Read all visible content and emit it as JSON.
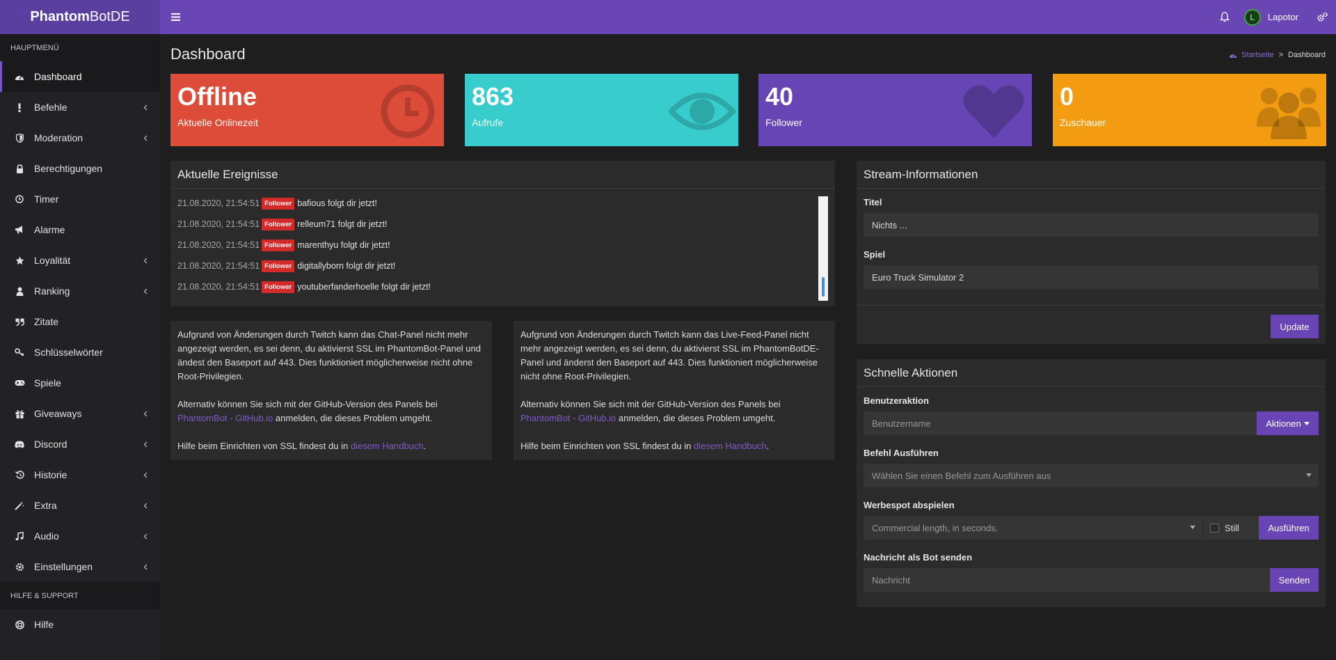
{
  "header": {
    "logo_bold": "Phantom",
    "logo_rest": "BotDE",
    "user_name": "Lapotor"
  },
  "sidebar": {
    "main_header": "HAUPTMENÜ",
    "items": [
      {
        "label": "Dashboard",
        "icon": "dashboard-icon",
        "chevron": false
      },
      {
        "label": "Befehle",
        "icon": "exclamation-icon",
        "chevron": true
      },
      {
        "label": "Moderation",
        "icon": "shield-icon",
        "chevron": true
      },
      {
        "label": "Berechtigungen",
        "icon": "lock-icon",
        "chevron": false
      },
      {
        "label": "Timer",
        "icon": "clock-icon",
        "chevron": false
      },
      {
        "label": "Alarme",
        "icon": "megaphone-icon",
        "chevron": false
      },
      {
        "label": "Loyalität",
        "icon": "star-icon",
        "chevron": true
      },
      {
        "label": "Ranking",
        "icon": "user-icon",
        "chevron": true
      },
      {
        "label": "Zitate",
        "icon": "quote-icon",
        "chevron": false
      },
      {
        "label": "Schlüsselwörter",
        "icon": "key-icon",
        "chevron": false
      },
      {
        "label": "Spiele",
        "icon": "gamepad-icon",
        "chevron": false
      },
      {
        "label": "Giveaways",
        "icon": "gift-icon",
        "chevron": true
      },
      {
        "label": "Discord",
        "icon": "discord-icon",
        "chevron": true
      },
      {
        "label": "Historie",
        "icon": "history-icon",
        "chevron": true
      },
      {
        "label": "Extra",
        "icon": "magic-wand-icon",
        "chevron": true
      },
      {
        "label": "Audio",
        "icon": "music-icon",
        "chevron": true
      },
      {
        "label": "Einstellungen",
        "icon": "gear-icon",
        "chevron": true
      }
    ],
    "help_header": "HILFE & SUPPORT",
    "help_item": "Hilfe"
  },
  "main": {
    "page_title": "Dashboard",
    "breadcrumb_home": "Startseite",
    "breadcrumb_sep": ">",
    "breadcrumb_current": "Dashboard",
    "stat_boxes": [
      {
        "value": "Offline",
        "label": "Aktuelle Onlinezeit",
        "color": "#dd4b39",
        "icon": "clock-icon"
      },
      {
        "value": "863",
        "label": "Aufrufe",
        "color": "#39cccc",
        "icon": "eye-icon"
      },
      {
        "value": "40",
        "label": "Follower",
        "color": "#6745b5",
        "icon": "heart-icon"
      },
      {
        "value": "0",
        "label": "Zuschauer",
        "color": "#f39c12",
        "icon": "users-icon"
      }
    ],
    "events": {
      "title": "Aktuelle Ereignisse",
      "rows": [
        {
          "time": "21.08.2020, 21:54:51",
          "badge": "Follower",
          "msg": "bafious folgt dir jetzt!"
        },
        {
          "time": "21.08.2020, 21:54:51",
          "badge": "Follower",
          "msg": "relleum71 folgt dir jetzt!"
        },
        {
          "time": "21.08.2020, 21:54:51",
          "badge": "Follower",
          "msg": "marenthyu folgt dir jetzt!"
        },
        {
          "time": "21.08.2020, 21:54:51",
          "badge": "Follower",
          "msg": "digitallyborn folgt dir jetzt!"
        },
        {
          "time": "21.08.2020, 21:54:51",
          "badge": "Follower",
          "msg": "youtuberfanderhoelle folgt dir jetzt!"
        }
      ]
    },
    "chat_panel": {
      "p1": "Aufgrund von Änderungen durch Twitch kann das Chat-Panel nicht mehr angezeigt werden, es sei denn, du aktivierst SSL im PhantomBot-Panel und ändest den Baseport auf 443. Dies funktioniert möglicherweise nicht ohne Root-Privilegien.",
      "p2_pre": "Alternativ können Sie sich mit der GitHub-Version des Panels bei ",
      "p2_link": "PhantomBot - GitHub.io",
      "p2_post": " anmelden, die dieses Problem umgeht.",
      "p3_pre": "Hilfe beim Einrichten von SSL findest du in ",
      "p3_link": "diesem Handbuch",
      "p3_post": "."
    },
    "feed_panel": {
      "p1": "Aufgrund von Änderungen durch Twitch kann das Live-Feed-Panel nicht mehr angezeigt werden, es sei denn, du aktivierst SSL im PhantomBotDE-Panel und änderst den Baseport auf 443. Dies funktioniert möglicherweise nicht ohne Root-Privilegien.",
      "p2_pre": "Alternativ können Sie sich mit der GitHub-Version des Panels bei ",
      "p2_link": "PhantomBot - GitHub.io",
      "p2_post": " anmelden, die dieses Problem umgeht.",
      "p3_pre": "Hilfe beim Einrichten von SSL findest du in ",
      "p3_link": "diesem Handbuch",
      "p3_post": "."
    },
    "stream_info": {
      "title": "Stream-Informationen",
      "title_label": "Titel",
      "title_value": "Nichts ...",
      "game_label": "Spiel",
      "game_value": "Euro Truck Simulator 2",
      "update_button": "Update"
    },
    "quick_actions": {
      "title": "Schnelle Aktionen",
      "user_action_label": "Benutzeraktion",
      "username_placeholder": "Benutzername",
      "actions_button": "Aktionen",
      "command_label": "Befehl Ausführen",
      "command_placeholder": "Wählen Sie einen Befehl zum Ausführen aus",
      "commercial_label": "Werbespot abspielen",
      "commercial_placeholder": "Commercial length, in seconds.",
      "still_label": "Still",
      "run_button": "Ausführen",
      "bot_message_label": "Nachricht als Bot senden",
      "message_placeholder": "Nachricht",
      "send_button": "Senden"
    }
  }
}
